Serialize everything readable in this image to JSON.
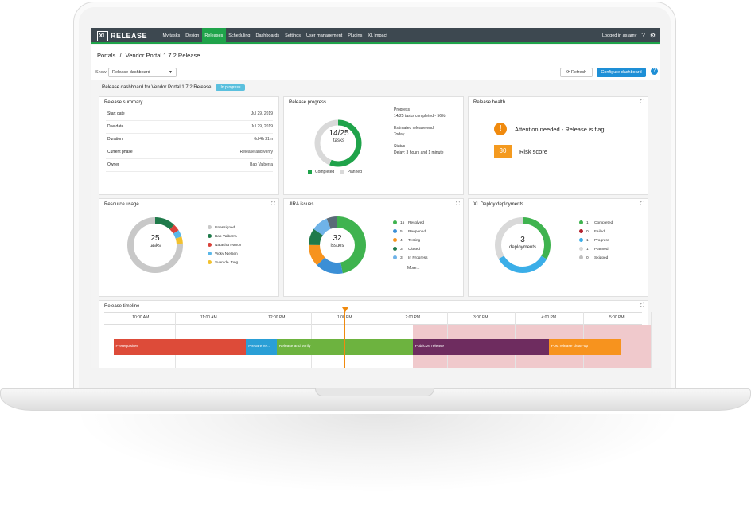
{
  "app": {
    "logo_short": "XL",
    "logo_name": "RELEASE",
    "nav": [
      "My tasks",
      "Design",
      "Releases",
      "Scheduling",
      "Dashboards",
      "Settings",
      "User management",
      "Plugins",
      "XL Impact"
    ],
    "active_nav": "Releases",
    "user_label": "Logged in as amy"
  },
  "header": {
    "breadcrumb_root": "Portals",
    "breadcrumb_sep": "/",
    "breadcrumb_current": "Vendor Portal 1.7.2 Release"
  },
  "toolbar": {
    "show_label": "Show",
    "show_value": "Release dashboard",
    "refresh_label": "Refresh",
    "configure_label": "Configure dashboard"
  },
  "dashboard": {
    "title": "Release dashboard for Vendor Portal 1.7.2 Release",
    "status": "In progress"
  },
  "summary": {
    "title": "Release summary",
    "rows": [
      {
        "key": "Start date",
        "value": "Jul 29, 2019"
      },
      {
        "key": "Due date",
        "value": "Jul 29, 2019"
      },
      {
        "key": "Duration",
        "value": "0d 4h 21m"
      },
      {
        "key": "Current phase",
        "value": "Release and verify"
      },
      {
        "key": "Owner",
        "value": "Bao Valberra"
      }
    ]
  },
  "progress": {
    "title": "Release progress",
    "center_value": "14/25",
    "center_label": "tasks",
    "completed_fraction": 0.56,
    "progress_label": "Progress",
    "progress_text": "14/25 tasks completed - 56%",
    "end_label": "Estimated release end",
    "end_value": "Today",
    "status_label": "Status",
    "status_value": "Delay: 3 hours and 1 minute",
    "legend_completed": "Completed",
    "legend_planned": "Planned",
    "color_completed": "#1fa34a",
    "color_planned": "#d9d9d9"
  },
  "health": {
    "title": "Release health",
    "attention_text": "Attention needed - Release is flag...",
    "risk_value": "30",
    "risk_label": "Risk score"
  },
  "resources": {
    "title": "Resource usage",
    "center_value": "25",
    "center_label": "tasks",
    "items": [
      {
        "name": "Unassigned",
        "color": "#c8c8c8",
        "value": 19
      },
      {
        "name": "Bao Valberra",
        "color": "#1f7a4a",
        "value": 3
      },
      {
        "name": "Natasha Ivanov",
        "color": "#d9423a",
        "value": 1
      },
      {
        "name": "Vicky Nielsen",
        "color": "#5ab7e8",
        "value": 1
      },
      {
        "name": "Sven de Jong",
        "color": "#f2c12e",
        "value": 1
      }
    ]
  },
  "jira": {
    "title": "JIRA issues",
    "center_value": "32",
    "center_label": "issues",
    "items": [
      {
        "count": "15",
        "name": "Resolved",
        "color": "#3fb34f",
        "value": 15
      },
      {
        "count": "5",
        "name": "Reopened",
        "color": "#3b8fd6",
        "value": 5
      },
      {
        "count": "4",
        "name": "Testing",
        "color": "#f7931e",
        "value": 4
      },
      {
        "count": "3",
        "name": "Closed",
        "color": "#1f7a4a",
        "value": 3
      },
      {
        "count": "3",
        "name": "In Progress",
        "color": "#6fb3e8",
        "value": 3
      }
    ],
    "others_value": 2,
    "others_color": "#5a6b78",
    "more_label": "More..."
  },
  "deploy": {
    "title": "XL Deploy deployments",
    "center_value": "3",
    "center_label": "deployments",
    "items": [
      {
        "count": "1",
        "name": "Completed",
        "color": "#3fb34f",
        "value": 1
      },
      {
        "count": "0",
        "name": "Failed",
        "color": "#b3202d",
        "value": 0
      },
      {
        "count": "1",
        "name": "Progress",
        "color": "#3baee8",
        "value": 1
      },
      {
        "count": "1",
        "name": "Planned",
        "color": "#d9d9d9",
        "value": 1
      },
      {
        "count": "0",
        "name": "Skipped",
        "color": "#c0c0c0",
        "value": 0
      }
    ]
  },
  "timeline": {
    "title": "Release timeline",
    "ticks": [
      "10:00 AM",
      "11:00 AM",
      "12:00 PM",
      "1:00 PM",
      "2:00 PM",
      "3:00 PM",
      "4:00 PM",
      "5:00 PM"
    ],
    "now_hour": 13.0,
    "delay_start_hour": 14.0,
    "delay_end_hour": 17.5,
    "phases": [
      {
        "name": "Prerequisites",
        "start": 9.6,
        "end": 11.55,
        "color": "#dd4b39"
      },
      {
        "name": "Prepare re...",
        "start": 11.55,
        "end": 12.0,
        "color": "#2a9fd6"
      },
      {
        "name": "Release and verify",
        "start": 12.0,
        "end": 14.0,
        "color": "#6db33f"
      },
      {
        "name": "Publicize release",
        "start": 14.0,
        "end": 16.0,
        "color": "#6e2c5f"
      },
      {
        "name": "Post release clean-up",
        "start": 16.0,
        "end": 17.05,
        "color": "#f7931e"
      }
    ]
  }
}
